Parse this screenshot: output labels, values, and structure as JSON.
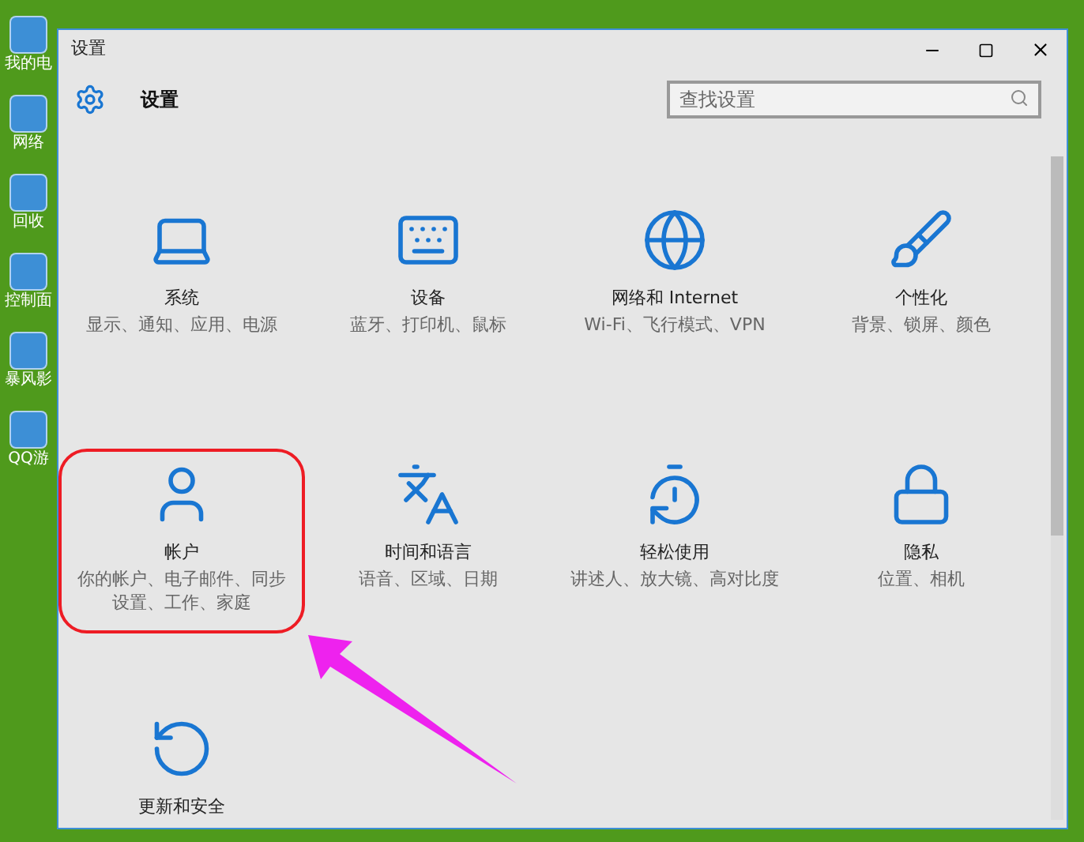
{
  "desktop_icons": [
    {
      "label": "我的电"
    },
    {
      "label": "网络"
    },
    {
      "label": "回收"
    },
    {
      "label": "控制面"
    },
    {
      "label": "暴风影"
    },
    {
      "label": "QQ游"
    }
  ],
  "window": {
    "title": "设置"
  },
  "header": {
    "title": "设置",
    "search": {
      "placeholder": "查找设置"
    }
  },
  "tiles": [
    {
      "title": "系统",
      "description": "显示、通知、应用、电源",
      "highlighted": false
    },
    {
      "title": "设备",
      "description": "蓝牙、打印机、鼠标",
      "highlighted": false
    },
    {
      "title": "网络和 Internet",
      "description": "Wi-Fi、飞行模式、VPN",
      "highlighted": false
    },
    {
      "title": "个性化",
      "description": "背景、锁屏、颜色",
      "highlighted": false
    },
    {
      "title": "帐户",
      "description": "你的帐户、电子邮件、同步设置、工作、家庭",
      "highlighted": true
    },
    {
      "title": "时间和语言",
      "description": "语音、区域、日期",
      "highlighted": false
    },
    {
      "title": "轻松使用",
      "description": "讲述人、放大镜、高对比度",
      "highlighted": false
    },
    {
      "title": "隐私",
      "description": "位置、相机",
      "highlighted": false
    },
    {
      "title": "更新和安全",
      "highlighted": false
    }
  ]
}
